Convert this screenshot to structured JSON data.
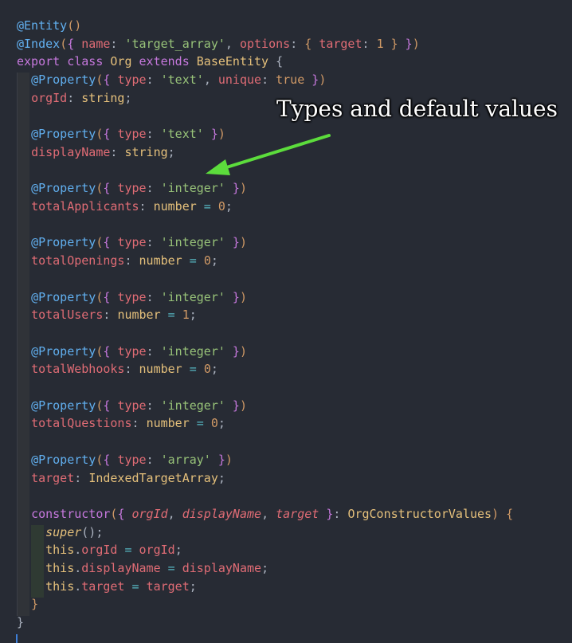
{
  "theme": {
    "background": "#272b34",
    "annotation_color": "#ffffff",
    "arrow_color": "#5cdc3c"
  },
  "annotation": {
    "text": "Types and default values"
  },
  "code_lines": [
    [
      {
        "t": "@Entity",
        "c": "dec"
      },
      {
        "t": "()",
        "c": "paren"
      }
    ],
    [
      {
        "t": "@Index",
        "c": "dec"
      },
      {
        "t": "(",
        "c": "paren"
      },
      {
        "t": "{ ",
        "c": "brace"
      },
      {
        "t": "name",
        "c": "key"
      },
      {
        "t": ": ",
        "c": "plain"
      },
      {
        "t": "'target_array'",
        "c": "str"
      },
      {
        "t": ", ",
        "c": "plain"
      },
      {
        "t": "options",
        "c": "key"
      },
      {
        "t": ": ",
        "c": "plain"
      },
      {
        "t": "{ ",
        "c": "paren"
      },
      {
        "t": "target",
        "c": "key"
      },
      {
        "t": ": ",
        "c": "plain"
      },
      {
        "t": "1",
        "c": "num"
      },
      {
        "t": " }",
        "c": "paren"
      },
      {
        "t": " }",
        "c": "brace"
      },
      {
        "t": ")",
        "c": "paren"
      }
    ],
    [
      {
        "t": "export ",
        "c": "kw"
      },
      {
        "t": "class ",
        "c": "kw"
      },
      {
        "t": "Org ",
        "c": "cls"
      },
      {
        "t": "extends ",
        "c": "kw"
      },
      {
        "t": "BaseEntity ",
        "c": "cls"
      },
      {
        "t": "{",
        "c": "plain"
      }
    ],
    [
      {
        "t": "  "
      },
      {
        "t": "@Property",
        "c": "dec"
      },
      {
        "t": "(",
        "c": "paren"
      },
      {
        "t": "{ ",
        "c": "brace"
      },
      {
        "t": "type",
        "c": "key"
      },
      {
        "t": ": ",
        "c": "plain"
      },
      {
        "t": "'text'",
        "c": "str"
      },
      {
        "t": ", ",
        "c": "plain"
      },
      {
        "t": "unique",
        "c": "key"
      },
      {
        "t": ": ",
        "c": "plain"
      },
      {
        "t": "true",
        "c": "num"
      },
      {
        "t": " }",
        "c": "brace"
      },
      {
        "t": ")",
        "c": "paren"
      }
    ],
    [
      {
        "t": "  "
      },
      {
        "t": "orgId",
        "c": "prop"
      },
      {
        "t": ": ",
        "c": "plain"
      },
      {
        "t": "string",
        "c": "type"
      },
      {
        "t": ";",
        "c": "plain"
      }
    ],
    [],
    [
      {
        "t": "  "
      },
      {
        "t": "@Property",
        "c": "dec"
      },
      {
        "t": "(",
        "c": "paren"
      },
      {
        "t": "{ ",
        "c": "brace"
      },
      {
        "t": "type",
        "c": "key"
      },
      {
        "t": ": ",
        "c": "plain"
      },
      {
        "t": "'text'",
        "c": "str"
      },
      {
        "t": " }",
        "c": "brace"
      },
      {
        "t": ")",
        "c": "paren"
      }
    ],
    [
      {
        "t": "  "
      },
      {
        "t": "displayName",
        "c": "prop"
      },
      {
        "t": ": ",
        "c": "plain"
      },
      {
        "t": "string",
        "c": "type"
      },
      {
        "t": ";",
        "c": "plain"
      }
    ],
    [],
    [
      {
        "t": "  "
      },
      {
        "t": "@Property",
        "c": "dec"
      },
      {
        "t": "(",
        "c": "paren"
      },
      {
        "t": "{ ",
        "c": "brace"
      },
      {
        "t": "type",
        "c": "key"
      },
      {
        "t": ": ",
        "c": "plain"
      },
      {
        "t": "'integer'",
        "c": "str"
      },
      {
        "t": " }",
        "c": "brace"
      },
      {
        "t": ")",
        "c": "paren"
      }
    ],
    [
      {
        "t": "  "
      },
      {
        "t": "totalApplicants",
        "c": "prop"
      },
      {
        "t": ": ",
        "c": "plain"
      },
      {
        "t": "number",
        "c": "type"
      },
      {
        "t": " = ",
        "c": "op"
      },
      {
        "t": "0",
        "c": "num"
      },
      {
        "t": ";",
        "c": "plain"
      }
    ],
    [],
    [
      {
        "t": "  "
      },
      {
        "t": "@Property",
        "c": "dec"
      },
      {
        "t": "(",
        "c": "paren"
      },
      {
        "t": "{ ",
        "c": "brace"
      },
      {
        "t": "type",
        "c": "key"
      },
      {
        "t": ": ",
        "c": "plain"
      },
      {
        "t": "'integer'",
        "c": "str"
      },
      {
        "t": " }",
        "c": "brace"
      },
      {
        "t": ")",
        "c": "paren"
      }
    ],
    [
      {
        "t": "  "
      },
      {
        "t": "totalOpenings",
        "c": "prop"
      },
      {
        "t": ": ",
        "c": "plain"
      },
      {
        "t": "number",
        "c": "type"
      },
      {
        "t": " = ",
        "c": "op"
      },
      {
        "t": "0",
        "c": "num"
      },
      {
        "t": ";",
        "c": "plain"
      }
    ],
    [],
    [
      {
        "t": "  "
      },
      {
        "t": "@Property",
        "c": "dec"
      },
      {
        "t": "(",
        "c": "paren"
      },
      {
        "t": "{ ",
        "c": "brace"
      },
      {
        "t": "type",
        "c": "key"
      },
      {
        "t": ": ",
        "c": "plain"
      },
      {
        "t": "'integer'",
        "c": "str"
      },
      {
        "t": " }",
        "c": "brace"
      },
      {
        "t": ")",
        "c": "paren"
      }
    ],
    [
      {
        "t": "  "
      },
      {
        "t": "totalUsers",
        "c": "prop"
      },
      {
        "t": ": ",
        "c": "plain"
      },
      {
        "t": "number",
        "c": "type"
      },
      {
        "t": " = ",
        "c": "op"
      },
      {
        "t": "1",
        "c": "num"
      },
      {
        "t": ";",
        "c": "plain"
      }
    ],
    [],
    [
      {
        "t": "  "
      },
      {
        "t": "@Property",
        "c": "dec"
      },
      {
        "t": "(",
        "c": "paren"
      },
      {
        "t": "{ ",
        "c": "brace"
      },
      {
        "t": "type",
        "c": "key"
      },
      {
        "t": ": ",
        "c": "plain"
      },
      {
        "t": "'integer'",
        "c": "str"
      },
      {
        "t": " }",
        "c": "brace"
      },
      {
        "t": ")",
        "c": "paren"
      }
    ],
    [
      {
        "t": "  "
      },
      {
        "t": "totalWebhooks",
        "c": "prop"
      },
      {
        "t": ": ",
        "c": "plain"
      },
      {
        "t": "number",
        "c": "type"
      },
      {
        "t": " = ",
        "c": "op"
      },
      {
        "t": "0",
        "c": "num"
      },
      {
        "t": ";",
        "c": "plain"
      }
    ],
    [],
    [
      {
        "t": "  "
      },
      {
        "t": "@Property",
        "c": "dec"
      },
      {
        "t": "(",
        "c": "paren"
      },
      {
        "t": "{ ",
        "c": "brace"
      },
      {
        "t": "type",
        "c": "key"
      },
      {
        "t": ": ",
        "c": "plain"
      },
      {
        "t": "'integer'",
        "c": "str"
      },
      {
        "t": " }",
        "c": "brace"
      },
      {
        "t": ")",
        "c": "paren"
      }
    ],
    [
      {
        "t": "  "
      },
      {
        "t": "totalQuestions",
        "c": "prop"
      },
      {
        "t": ": ",
        "c": "plain"
      },
      {
        "t": "number",
        "c": "type"
      },
      {
        "t": " = ",
        "c": "op"
      },
      {
        "t": "0",
        "c": "num"
      },
      {
        "t": ";",
        "c": "plain"
      }
    ],
    [],
    [
      {
        "t": "  "
      },
      {
        "t": "@Property",
        "c": "dec"
      },
      {
        "t": "(",
        "c": "paren"
      },
      {
        "t": "{ ",
        "c": "brace"
      },
      {
        "t": "type",
        "c": "key"
      },
      {
        "t": ": ",
        "c": "plain"
      },
      {
        "t": "'array'",
        "c": "str"
      },
      {
        "t": " }",
        "c": "brace"
      },
      {
        "t": ")",
        "c": "paren"
      }
    ],
    [
      {
        "t": "  "
      },
      {
        "t": "target",
        "c": "prop"
      },
      {
        "t": ": ",
        "c": "plain"
      },
      {
        "t": "IndexedTargetArray",
        "c": "type"
      },
      {
        "t": ";",
        "c": "plain"
      }
    ],
    [],
    [
      {
        "t": "  "
      },
      {
        "t": "constructor",
        "c": "kw"
      },
      {
        "t": "(",
        "c": "paren"
      },
      {
        "t": "{ ",
        "c": "brace"
      },
      {
        "t": "orgId",
        "c": "param"
      },
      {
        "t": ", ",
        "c": "plain"
      },
      {
        "t": "displayName",
        "c": "param"
      },
      {
        "t": ", ",
        "c": "plain"
      },
      {
        "t": "target",
        "c": "param"
      },
      {
        "t": " }",
        "c": "brace"
      },
      {
        "t": ": ",
        "c": "plain"
      },
      {
        "t": "OrgConstructorValues",
        "c": "type"
      },
      {
        "t": ") ",
        "c": "paren"
      },
      {
        "t": "{",
        "c": "paren"
      }
    ],
    [
      {
        "t": "    "
      },
      {
        "t": "super",
        "c": "superc"
      },
      {
        "t": "();",
        "c": "plain"
      }
    ],
    [
      {
        "t": "    "
      },
      {
        "t": "this",
        "c": "this"
      },
      {
        "t": ".",
        "c": "plain"
      },
      {
        "t": "orgId",
        "c": "prop"
      },
      {
        "t": " = ",
        "c": "op"
      },
      {
        "t": "orgId",
        "c": "prop"
      },
      {
        "t": ";",
        "c": "plain"
      }
    ],
    [
      {
        "t": "    "
      },
      {
        "t": "this",
        "c": "this"
      },
      {
        "t": ".",
        "c": "plain"
      },
      {
        "t": "displayName",
        "c": "prop"
      },
      {
        "t": " = ",
        "c": "op"
      },
      {
        "t": "displayName",
        "c": "prop"
      },
      {
        "t": ";",
        "c": "plain"
      }
    ],
    [
      {
        "t": "    "
      },
      {
        "t": "this",
        "c": "this"
      },
      {
        "t": ".",
        "c": "plain"
      },
      {
        "t": "target",
        "c": "prop"
      },
      {
        "t": " = ",
        "c": "op"
      },
      {
        "t": "target",
        "c": "prop"
      },
      {
        "t": ";",
        "c": "plain"
      }
    ],
    [
      {
        "t": "  "
      },
      {
        "t": "}",
        "c": "paren"
      }
    ],
    [
      {
        "t": "}",
        "c": "plain"
      }
    ]
  ]
}
